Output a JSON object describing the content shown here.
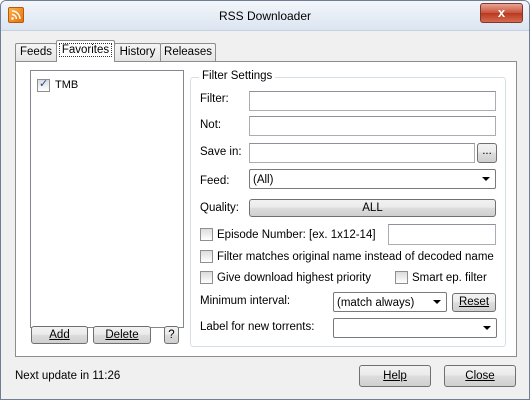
{
  "window": {
    "title": "RSS Downloader",
    "close_glyph": "x",
    "icon": "rss-feed-icon"
  },
  "tabs": [
    {
      "label": "Feeds",
      "active": false
    },
    {
      "label": "Favorites",
      "active": true
    },
    {
      "label": "History",
      "active": false
    },
    {
      "label": "Releases",
      "active": false
    }
  ],
  "favorites": {
    "items": [
      {
        "label": "TMB",
        "checked": true
      }
    ],
    "add_button": "Add",
    "delete_button": "Delete",
    "help_button": "?"
  },
  "filter_settings": {
    "group_title": "Filter Settings",
    "filter_label": "Filter:",
    "filter_value": "",
    "not_label": "Not:",
    "not_value": "",
    "save_in_label": "Save in:",
    "save_in_value": "",
    "browse_button": "...",
    "feed_label": "Feed:",
    "feed_value": "(All)",
    "quality_label": "Quality:",
    "quality_value": "ALL",
    "episode_label": "Episode Number: [ex. 1x12-14]",
    "episode_checked": false,
    "episode_value": "",
    "match_original_label": "Filter matches original name instead of decoded name",
    "match_original_checked": false,
    "high_priority_label": "Give download highest priority",
    "high_priority_checked": false,
    "smart_ep_label": "Smart ep. filter",
    "smart_ep_checked": false,
    "min_interval_label": "Minimum interval:",
    "min_interval_value": "(match always)",
    "reset_button": "Reset",
    "torrent_label_label": "Label for new torrents:",
    "torrent_label_value": ""
  },
  "footer": {
    "status": "Next update in 11:26",
    "help_button": "Help",
    "close_button": "Close"
  },
  "colors": {
    "title_gradient_top": "#f3f6fb",
    "close_button": "#c8523c",
    "panel_background": "#ffffff",
    "window_background": "#f0f0f0"
  }
}
